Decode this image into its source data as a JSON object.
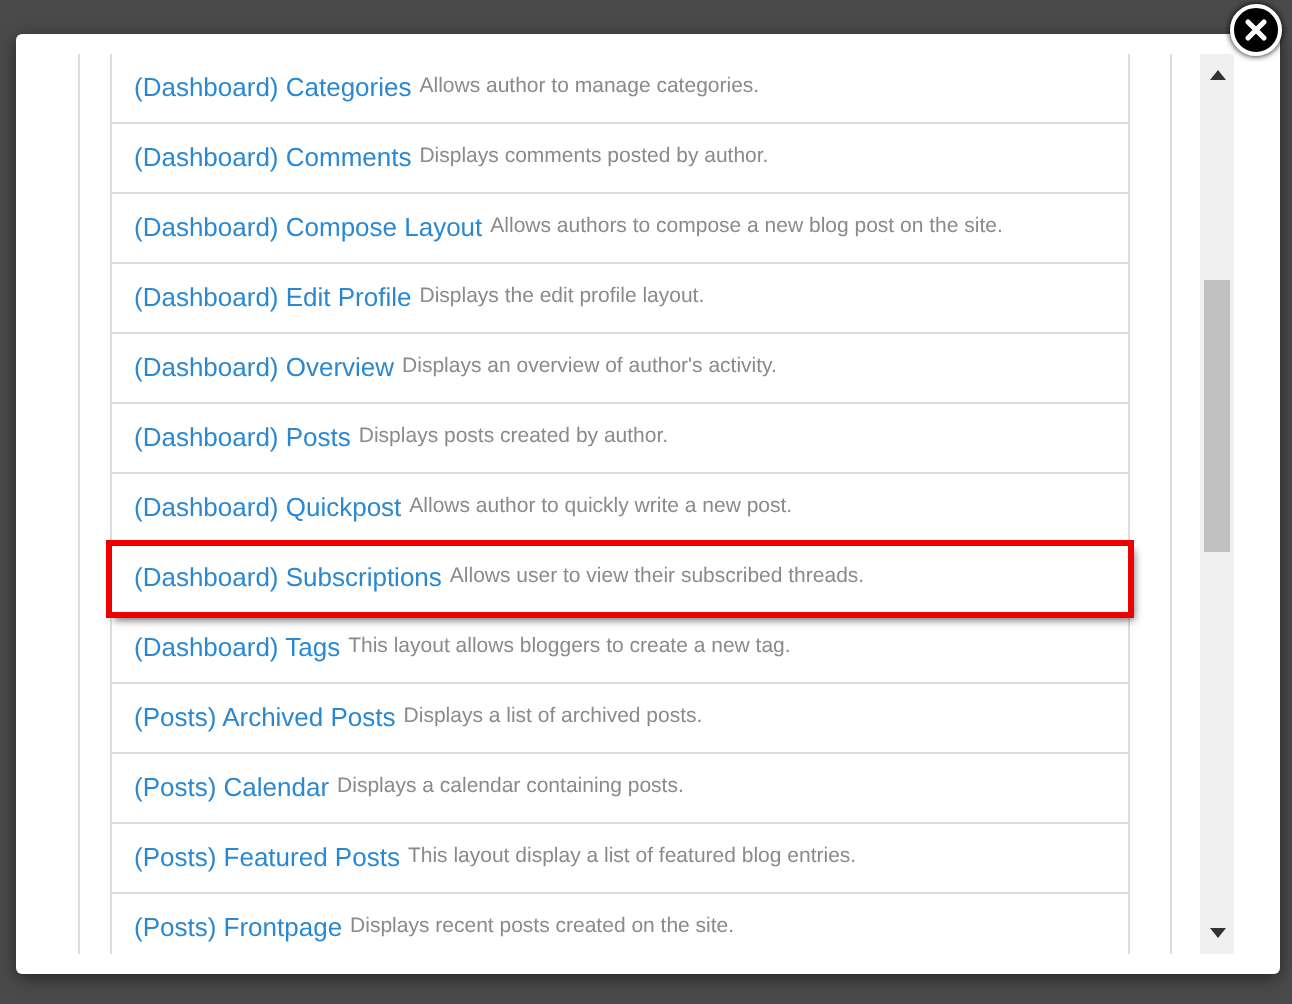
{
  "layouts": [
    {
      "title": "(Dashboard) Categories",
      "description": "Allows author to manage categories.",
      "highlighted": false
    },
    {
      "title": "(Dashboard) Comments",
      "description": "Displays comments posted by author.",
      "highlighted": false
    },
    {
      "title": "(Dashboard) Compose Layout",
      "description": "Allows authors to compose a new blog post on the site.",
      "highlighted": false
    },
    {
      "title": "(Dashboard) Edit Profile",
      "description": "Displays the edit profile layout.",
      "highlighted": false
    },
    {
      "title": "(Dashboard) Overview",
      "description": "Displays an overview of author's activity.",
      "highlighted": false
    },
    {
      "title": "(Dashboard) Posts",
      "description": "Displays posts created by author.",
      "highlighted": false
    },
    {
      "title": "(Dashboard) Quickpost",
      "description": "Allows author to quickly write a new post.",
      "highlighted": false
    },
    {
      "title": "(Dashboard) Subscriptions",
      "description": "Allows user to view their subscribed threads.",
      "highlighted": true
    },
    {
      "title": "(Dashboard) Tags",
      "description": "This layout allows bloggers to create a new tag.",
      "highlighted": false
    },
    {
      "title": "(Posts) Archived Posts",
      "description": "Displays a list of archived posts.",
      "highlighted": false
    },
    {
      "title": "(Posts) Calendar",
      "description": "Displays a calendar containing posts.",
      "highlighted": false
    },
    {
      "title": "(Posts) Featured Posts",
      "description": "This layout display a list of featured blog entries.",
      "highlighted": false
    },
    {
      "title": "(Posts) Frontpage",
      "description": "Displays recent posts created on the site.",
      "highlighted": false
    }
  ]
}
